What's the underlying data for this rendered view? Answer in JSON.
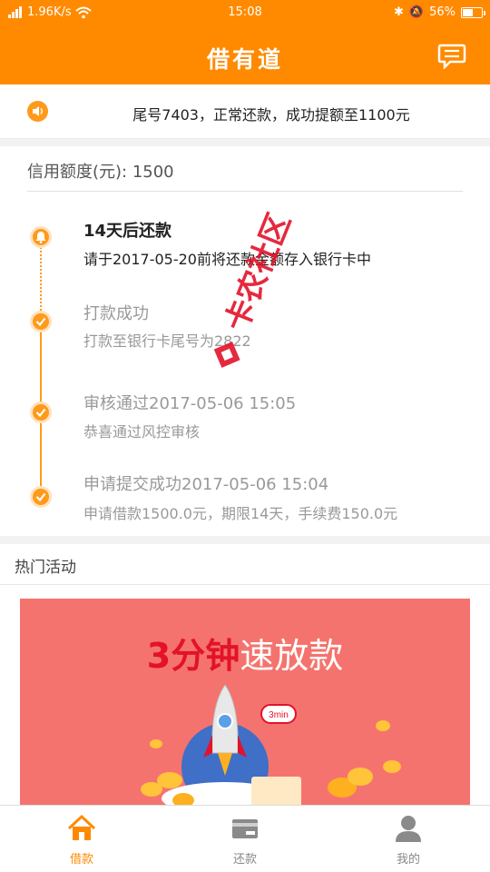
{
  "status_bar": {
    "signal": "4G",
    "network_speed": "1.96K/s",
    "time": "15:08",
    "battery": "56%",
    "battery_level": 0.56
  },
  "header": {
    "title": "借有道",
    "message_icon": "chat-bubble-icon"
  },
  "notice": {
    "icon": "speaker-icon",
    "text": "尾号7403，正常还款，成功提额至1100元"
  },
  "credit": {
    "text": "信用额度(元): 1500"
  },
  "timeline": [
    {
      "title": "14天后还款",
      "desc": "请于2017-05-20前将还款金额存入银行卡中",
      "status": "active",
      "icon": "bell-icon"
    },
    {
      "title": "打款成功",
      "desc": "打款至银行卡尾号为2822",
      "status": "done",
      "icon": "check-icon"
    },
    {
      "title": "审核通过2017-05-06 15:05",
      "desc": "恭喜通过风控审核",
      "status": "done",
      "icon": "check-icon"
    },
    {
      "title": "申请提交成功2017-05-06 15:04",
      "desc": "申请借款1500.0元，期限14天，手续费150.0元",
      "status": "done",
      "icon": "check-icon"
    }
  ],
  "hot_activities": {
    "title": "热门活动",
    "banner": {
      "title_red": "3分钟",
      "title_white": "速放款",
      "badge": "3min"
    }
  },
  "watermark": "卡农社区",
  "tabs": [
    {
      "label": "借款",
      "icon": "home-icon",
      "active": true
    },
    {
      "label": "还款",
      "icon": "card-icon",
      "active": false
    },
    {
      "label": "我的",
      "icon": "user-icon",
      "active": false
    }
  ],
  "colors": {
    "brand": "#ff8a00",
    "accent": "#ff9a1a",
    "banner_bg": "#f5736e",
    "banner_red": "#e3122a"
  }
}
